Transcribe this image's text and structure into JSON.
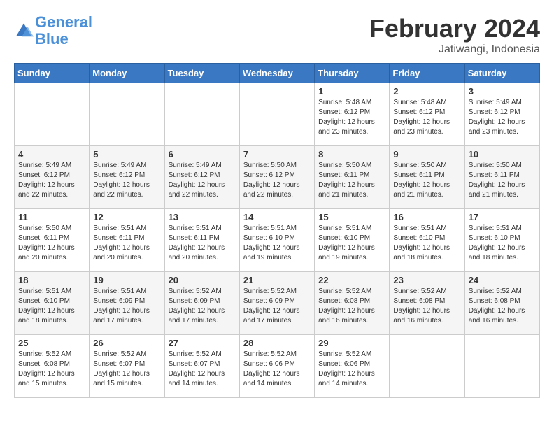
{
  "header": {
    "logo_line1": "General",
    "logo_line2": "Blue",
    "month_title": "February 2024",
    "location": "Jatiwangi, Indonesia"
  },
  "days_of_week": [
    "Sunday",
    "Monday",
    "Tuesday",
    "Wednesday",
    "Thursday",
    "Friday",
    "Saturday"
  ],
  "weeks": [
    [
      {
        "day": "",
        "info": ""
      },
      {
        "day": "",
        "info": ""
      },
      {
        "day": "",
        "info": ""
      },
      {
        "day": "",
        "info": ""
      },
      {
        "day": "1",
        "info": "Sunrise: 5:48 AM\nSunset: 6:12 PM\nDaylight: 12 hours\nand 23 minutes."
      },
      {
        "day": "2",
        "info": "Sunrise: 5:48 AM\nSunset: 6:12 PM\nDaylight: 12 hours\nand 23 minutes."
      },
      {
        "day": "3",
        "info": "Sunrise: 5:49 AM\nSunset: 6:12 PM\nDaylight: 12 hours\nand 23 minutes."
      }
    ],
    [
      {
        "day": "4",
        "info": "Sunrise: 5:49 AM\nSunset: 6:12 PM\nDaylight: 12 hours\nand 22 minutes."
      },
      {
        "day": "5",
        "info": "Sunrise: 5:49 AM\nSunset: 6:12 PM\nDaylight: 12 hours\nand 22 minutes."
      },
      {
        "day": "6",
        "info": "Sunrise: 5:49 AM\nSunset: 6:12 PM\nDaylight: 12 hours\nand 22 minutes."
      },
      {
        "day": "7",
        "info": "Sunrise: 5:50 AM\nSunset: 6:12 PM\nDaylight: 12 hours\nand 22 minutes."
      },
      {
        "day": "8",
        "info": "Sunrise: 5:50 AM\nSunset: 6:11 PM\nDaylight: 12 hours\nand 21 minutes."
      },
      {
        "day": "9",
        "info": "Sunrise: 5:50 AM\nSunset: 6:11 PM\nDaylight: 12 hours\nand 21 minutes."
      },
      {
        "day": "10",
        "info": "Sunrise: 5:50 AM\nSunset: 6:11 PM\nDaylight: 12 hours\nand 21 minutes."
      }
    ],
    [
      {
        "day": "11",
        "info": "Sunrise: 5:50 AM\nSunset: 6:11 PM\nDaylight: 12 hours\nand 20 minutes."
      },
      {
        "day": "12",
        "info": "Sunrise: 5:51 AM\nSunset: 6:11 PM\nDaylight: 12 hours\nand 20 minutes."
      },
      {
        "day": "13",
        "info": "Sunrise: 5:51 AM\nSunset: 6:11 PM\nDaylight: 12 hours\nand 20 minutes."
      },
      {
        "day": "14",
        "info": "Sunrise: 5:51 AM\nSunset: 6:10 PM\nDaylight: 12 hours\nand 19 minutes."
      },
      {
        "day": "15",
        "info": "Sunrise: 5:51 AM\nSunset: 6:10 PM\nDaylight: 12 hours\nand 19 minutes."
      },
      {
        "day": "16",
        "info": "Sunrise: 5:51 AM\nSunset: 6:10 PM\nDaylight: 12 hours\nand 18 minutes."
      },
      {
        "day": "17",
        "info": "Sunrise: 5:51 AM\nSunset: 6:10 PM\nDaylight: 12 hours\nand 18 minutes."
      }
    ],
    [
      {
        "day": "18",
        "info": "Sunrise: 5:51 AM\nSunset: 6:10 PM\nDaylight: 12 hours\nand 18 minutes."
      },
      {
        "day": "19",
        "info": "Sunrise: 5:51 AM\nSunset: 6:09 PM\nDaylight: 12 hours\nand 17 minutes."
      },
      {
        "day": "20",
        "info": "Sunrise: 5:52 AM\nSunset: 6:09 PM\nDaylight: 12 hours\nand 17 minutes."
      },
      {
        "day": "21",
        "info": "Sunrise: 5:52 AM\nSunset: 6:09 PM\nDaylight: 12 hours\nand 17 minutes."
      },
      {
        "day": "22",
        "info": "Sunrise: 5:52 AM\nSunset: 6:08 PM\nDaylight: 12 hours\nand 16 minutes."
      },
      {
        "day": "23",
        "info": "Sunrise: 5:52 AM\nSunset: 6:08 PM\nDaylight: 12 hours\nand 16 minutes."
      },
      {
        "day": "24",
        "info": "Sunrise: 5:52 AM\nSunset: 6:08 PM\nDaylight: 12 hours\nand 16 minutes."
      }
    ],
    [
      {
        "day": "25",
        "info": "Sunrise: 5:52 AM\nSunset: 6:08 PM\nDaylight: 12 hours\nand 15 minutes."
      },
      {
        "day": "26",
        "info": "Sunrise: 5:52 AM\nSunset: 6:07 PM\nDaylight: 12 hours\nand 15 minutes."
      },
      {
        "day": "27",
        "info": "Sunrise: 5:52 AM\nSunset: 6:07 PM\nDaylight: 12 hours\nand 14 minutes."
      },
      {
        "day": "28",
        "info": "Sunrise: 5:52 AM\nSunset: 6:06 PM\nDaylight: 12 hours\nand 14 minutes."
      },
      {
        "day": "29",
        "info": "Sunrise: 5:52 AM\nSunset: 6:06 PM\nDaylight: 12 hours\nand 14 minutes."
      },
      {
        "day": "",
        "info": ""
      },
      {
        "day": "",
        "info": ""
      }
    ]
  ]
}
